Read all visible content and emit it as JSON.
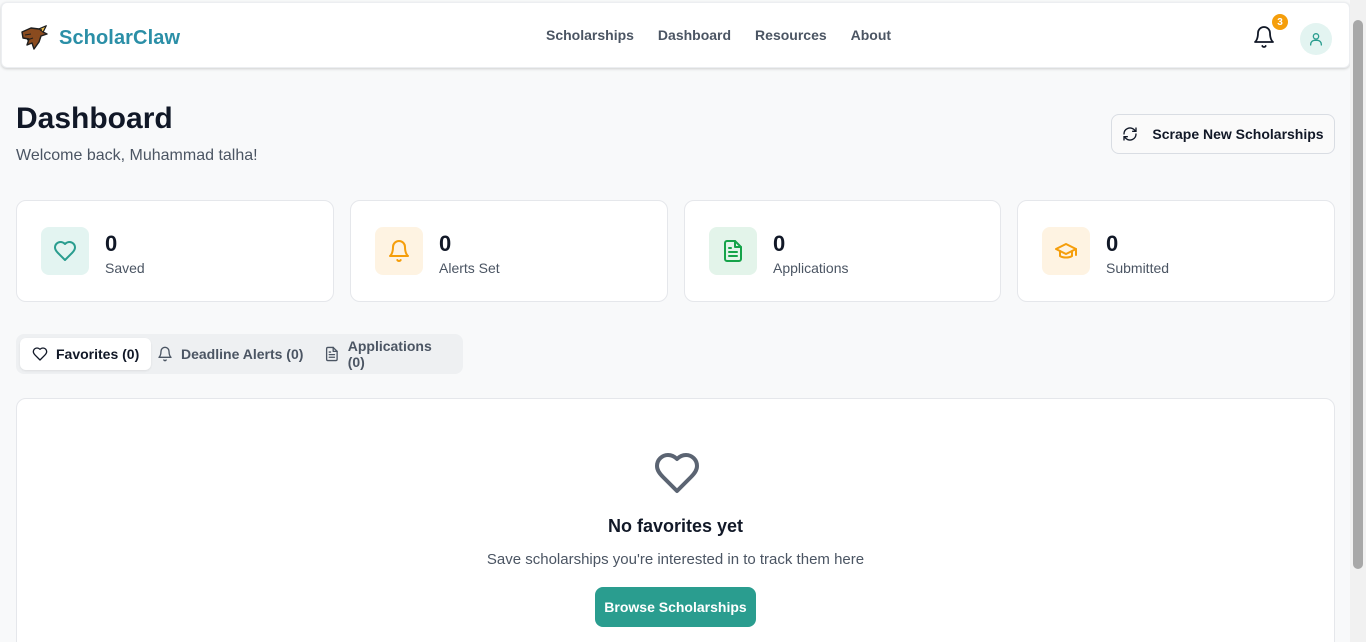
{
  "header": {
    "brand_name": "ScholarClaw",
    "nav": [
      {
        "label": "Scholarships"
      },
      {
        "label": "Dashboard"
      },
      {
        "label": "Resources"
      },
      {
        "label": "About"
      }
    ],
    "notification_count": "3",
    "brand_color": "#2b8fa7"
  },
  "page": {
    "title": "Dashboard",
    "welcome": "Welcome back, Muhammad talha!",
    "scrape_button_label": "Scrape New Scholarships"
  },
  "stats": [
    {
      "value": "0",
      "label": "Saved",
      "icon": "heart-icon",
      "accent": "#2a9d8f"
    },
    {
      "value": "0",
      "label": "Alerts Set",
      "icon": "bell-icon",
      "accent": "#f59e0b"
    },
    {
      "value": "0",
      "label": "Applications",
      "icon": "document-icon",
      "accent": "#16a34a"
    },
    {
      "value": "0",
      "label": "Submitted",
      "icon": "graduation-cap-icon",
      "accent": "#f59e0b"
    }
  ],
  "tabs": [
    {
      "label": "Favorites (0)",
      "icon": "heart-icon",
      "active": true
    },
    {
      "label": "Deadline Alerts (0)",
      "icon": "bell-icon",
      "active": false
    },
    {
      "label": "Applications (0)",
      "icon": "document-icon",
      "active": false
    }
  ],
  "empty_state": {
    "icon": "heart-icon",
    "title": "No favorites yet",
    "text": "Save scholarships you're interested in to track them here",
    "button_label": "Browse Scholarships",
    "button_color": "#2a9d8f"
  }
}
